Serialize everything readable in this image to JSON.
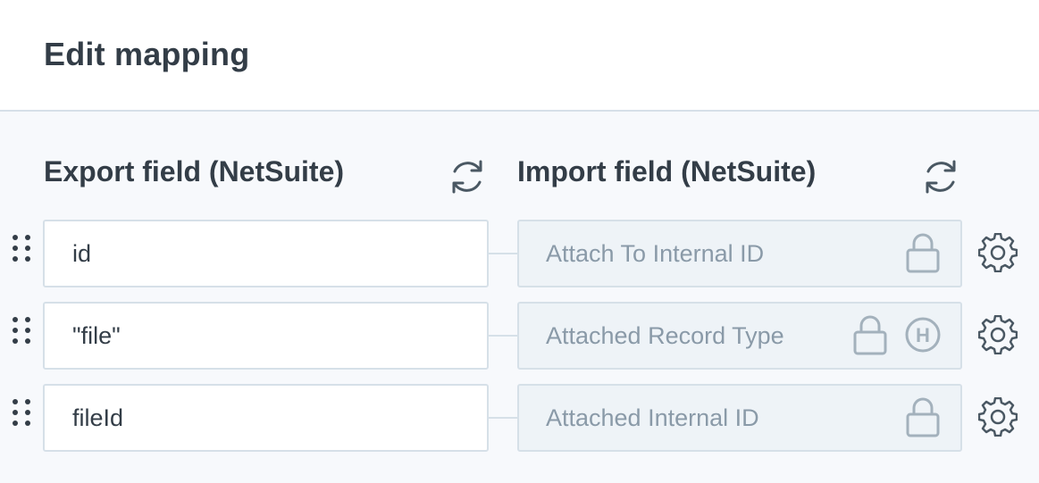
{
  "page": {
    "title": "Edit mapping"
  },
  "columns": {
    "export_title": "Export field (NetSuite)",
    "import_title": "Import field (NetSuite)"
  },
  "rows": [
    {
      "export_value": "id",
      "import_value": "Attach To Internal ID",
      "locked": true,
      "hardcoded_badge": ""
    },
    {
      "export_value": "\"file\"",
      "import_value": "Attached Record Type",
      "locked": true,
      "hardcoded_badge": "H"
    },
    {
      "export_value": "fileId",
      "import_value": "Attached Internal ID",
      "locked": true,
      "hardcoded_badge": ""
    }
  ],
  "icons": {
    "refresh": "refresh-icon",
    "drag": "drag-handle-icon",
    "lock": "lock-icon",
    "gear": "gear-icon",
    "hardcoded": "hardcoded-badge-icon"
  },
  "colors": {
    "text": "#333d47",
    "muted": "#8a9aa8",
    "border": "#d6e0e8",
    "locked_bg": "#eef3f7",
    "page_bg": "#f7f9fc",
    "icon": "#4a5863"
  }
}
